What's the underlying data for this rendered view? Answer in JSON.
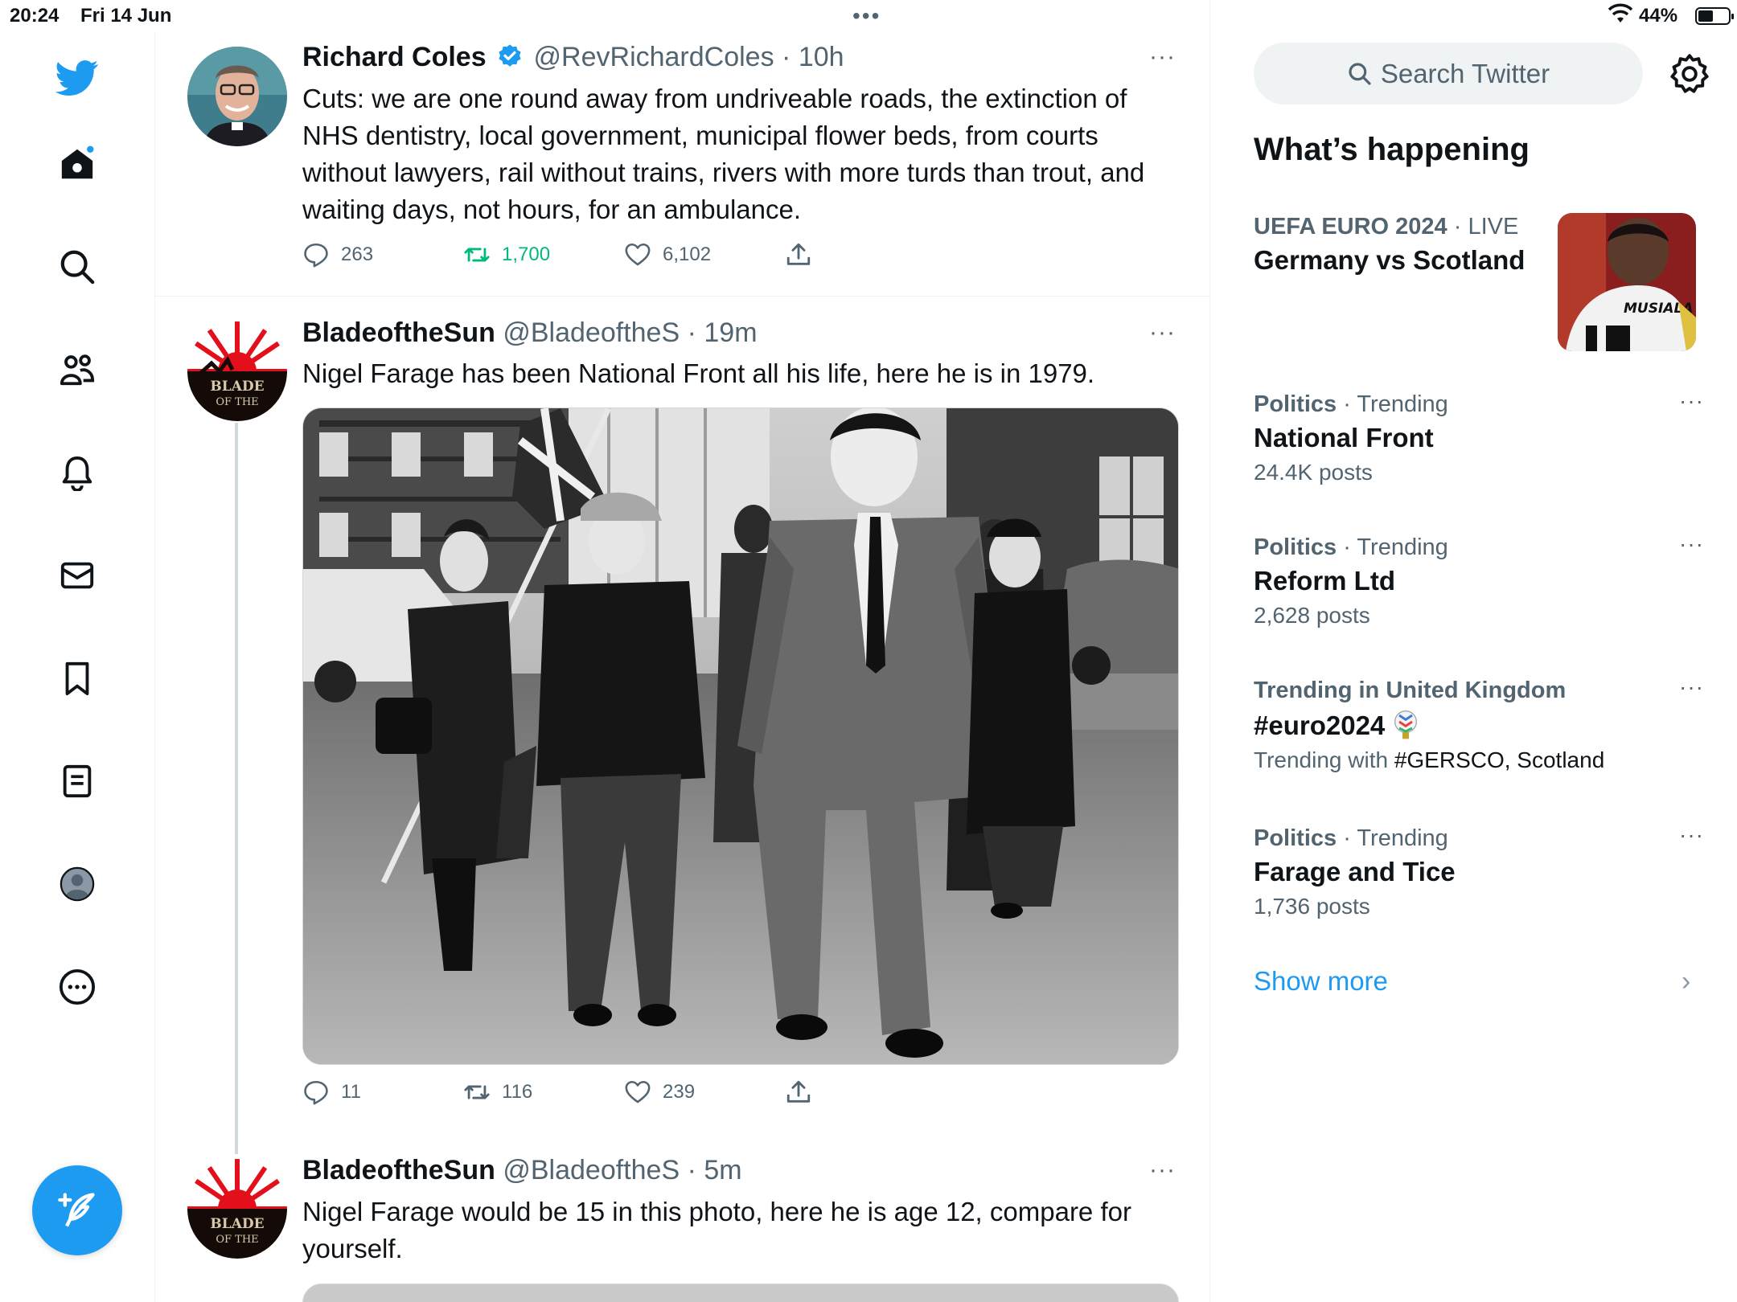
{
  "status_bar": {
    "time": "20:24",
    "date": "Fri 14 Jun",
    "battery": "44%"
  },
  "nav": {
    "icons": [
      "twitter-logo-icon",
      "home-icon",
      "search-icon",
      "communities-icon",
      "notifications-icon",
      "messages-icon",
      "bookmarks-icon",
      "lists-icon",
      "profile-icon",
      "more-icon",
      "compose-icon"
    ],
    "brand_color": "#1d9bf0"
  },
  "tweets": [
    {
      "name": "Richard Coles",
      "verified": true,
      "handle": "@RevRichardColes",
      "sep": "·",
      "ago": "10h",
      "text": "Cuts: we are one round away from undriveable roads, the extinction of NHS dentistry, local government, municipal flower beds, from courts without lawyers, rail without trains, rivers with more turds than trout, and waiting days, not hours, for an ambulance.",
      "replies": "263",
      "retweets": "1,700",
      "likes": "6,102",
      "retweeted": true
    },
    {
      "name": "BladeoftheSun",
      "verified": false,
      "handle": "@BladeoftheS",
      "sep": "·",
      "ago": "19m",
      "text": "Nigel Farage has been National Front all his life, here he is in 1979.",
      "replies": "11",
      "retweets": "116",
      "likes": "239",
      "retweeted": false
    },
    {
      "name": "BladeoftheSun",
      "verified": false,
      "handle": "@BladeoftheS",
      "sep": "·",
      "ago": "5m",
      "text": "Nigel Farage would be 15 in this photo, here he is age 12, compare for yourself."
    }
  ],
  "right": {
    "search_placeholder": "Search Twitter",
    "section_title": "What’s happening",
    "trends": [
      {
        "meta_bold": "UEFA EURO 2024",
        "meta_rest": " · LIVE",
        "title": "Germany vs Scotland",
        "sub": ""
      },
      {
        "meta_bold": "Politics",
        "meta_rest": " · Trending",
        "title": "National Front",
        "sub": "24.4K posts"
      },
      {
        "meta_bold": "Politics",
        "meta_rest": " · Trending",
        "title": "Reform Ltd",
        "sub": "2,628 posts"
      },
      {
        "meta_bold": "Trending in United Kingdom",
        "meta_rest": "",
        "title": "#euro2024",
        "sub_prefix": "Trending with ",
        "sub_dark": "#GERSCO, Scotland"
      },
      {
        "meta_bold": "Politics",
        "meta_rest": " · Trending",
        "title": "Farage and Tice",
        "sub": "1,736 posts"
      }
    ],
    "euro_thumb_text": "MUSIALA",
    "show_more": "Show more"
  },
  "avatar_text": {
    "blade_line1": "BLADE",
    "blade_line2": "OF THE"
  },
  "more_glyph": "···"
}
